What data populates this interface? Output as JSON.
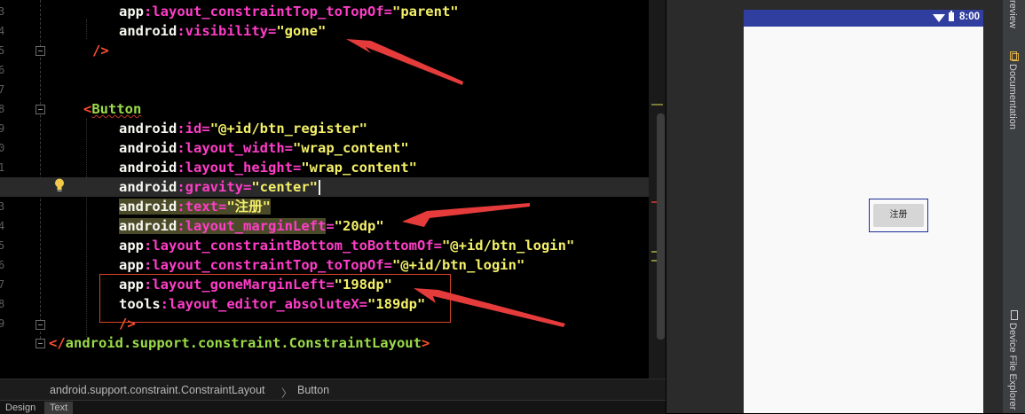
{
  "editor": {
    "gutter_digits": [
      "3",
      "4",
      "5",
      "6",
      "7",
      "8",
      "9",
      "0",
      "1",
      "2",
      "3",
      "4",
      "5",
      "6",
      "7",
      "8",
      "9"
    ],
    "lines": {
      "l0": {
        "ns": "app",
        "colon": ":",
        "attr": "layout_constraintTop_toTopOf",
        "eq": "=",
        "val": "\"parent\""
      },
      "l1": {
        "ns": "android",
        "colon": ":",
        "attr": "visibility",
        "eq": "=",
        "val": "\"gone\""
      },
      "l2": {
        "text": "/>"
      },
      "l4": {
        "lt": "<",
        "tag": "Button"
      },
      "l5": {
        "ns": "android",
        "colon": ":",
        "attr": "id",
        "eq": "=",
        "val": "\"@+id/btn_register\""
      },
      "l6": {
        "ns": "android",
        "colon": ":",
        "attr": "layout_width",
        "eq": "=",
        "val": "\"wrap_content\""
      },
      "l7": {
        "ns": "android",
        "colon": ":",
        "attr": "layout_height",
        "eq": "=",
        "val": "\"wrap_content\""
      },
      "l8": {
        "ns": "android",
        "colon": ":",
        "attr": "gravity",
        "eq": "=",
        "val": "\"center\""
      },
      "l9": {
        "ns": "android",
        "colon": ":",
        "attr": "text",
        "eq": "=",
        "val": "\"注册\""
      },
      "l10": {
        "ns": "android",
        "colon": ":",
        "attr": "layout_marginLeft",
        "eq": "=",
        "val": "\"20dp\""
      },
      "l11": {
        "ns": "app",
        "colon": ":",
        "attr": "layout_constraintBottom_toBottomOf",
        "eq": "=",
        "val": "\"@+id/btn_login\""
      },
      "l12": {
        "ns": "app",
        "colon": ":",
        "attr": "layout_constraintTop_toTopOf",
        "eq": "=",
        "val": "\"@+id/btn_login\""
      },
      "l13": {
        "ns": "app",
        "colon": ":",
        "attr": "layout_goneMarginLeft",
        "eq": "=",
        "val": "\"198dp\""
      },
      "l14": {
        "ns": "tools",
        "colon": ":",
        "attr": "layout_editor_absoluteX",
        "eq": "=",
        "val": "\"189dp\""
      },
      "l15": {
        "text": "/>"
      },
      "l16": {
        "lt": "</",
        "tag": "android.support.constraint.ConstraintLayout",
        "gt": ">"
      }
    }
  },
  "breadcrumb": {
    "parent": "android.support.constraint.ConstraintLayout",
    "sep": "〉",
    "child": "Button"
  },
  "bottom_tabs": {
    "design": "Design",
    "text": "Text"
  },
  "preview": {
    "status_time": "8:00",
    "button_label": "注册"
  },
  "right_panel": {
    "top_tab": "review",
    "documentation": "Documentation",
    "device_file_explorer": "Device File Explorer"
  },
  "colors": {
    "status_bar": "#303f9f",
    "annotation": "#e63b3b",
    "attr": "#ff3dc8",
    "value": "#f4f069",
    "tag": "#9bdb48"
  }
}
